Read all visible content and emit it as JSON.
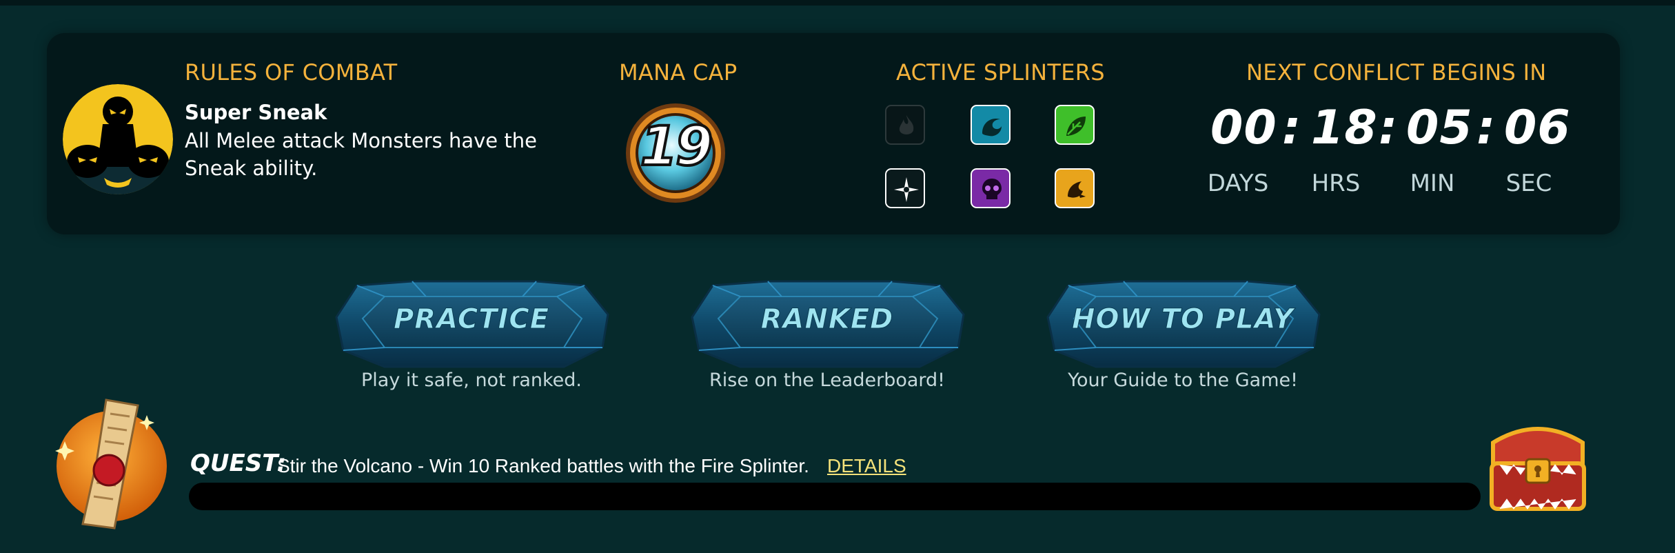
{
  "rules": {
    "header": "RULES OF COMBAT",
    "name": "Super Sneak",
    "description": "All Melee attack Monsters have the Sneak ability.",
    "icon": "super-sneak-icon"
  },
  "mana": {
    "header": "MANA CAP",
    "value": "19"
  },
  "splinters": {
    "header": "ACTIVE SPLINTERS",
    "items": [
      {
        "name": "fire",
        "active": false,
        "icon": "fire-splinter-icon",
        "color": "#3a3a3a"
      },
      {
        "name": "water",
        "active": true,
        "icon": "water-splinter-icon",
        "color": "#1fb6d8"
      },
      {
        "name": "earth",
        "active": true,
        "icon": "earth-splinter-icon",
        "color": "#2fb52f"
      },
      {
        "name": "life",
        "active": true,
        "icon": "life-splinter-icon",
        "color": "#f0f0f0"
      },
      {
        "name": "death",
        "active": true,
        "icon": "death-splinter-icon",
        "color": "#8a2fb0"
      },
      {
        "name": "dragon",
        "active": true,
        "icon": "dragon-splinter-icon",
        "color": "#f2b021"
      }
    ]
  },
  "timer": {
    "header": "NEXT CONFLICT BEGINS IN",
    "days": "00",
    "hrs": "18",
    "min": "05",
    "sec": "06",
    "sep": ":",
    "labels": {
      "days": "DAYS",
      "hrs": "HRS",
      "min": "MIN",
      "sec": "SEC"
    }
  },
  "modes": [
    {
      "label": "PRACTICE",
      "subtitle": "Play it safe, not ranked."
    },
    {
      "label": "RANKED",
      "subtitle": "Rise on the Leaderboard!"
    },
    {
      "label": "HOW TO PLAY",
      "subtitle": "Your Guide to the Game!"
    }
  ],
  "quest": {
    "title": "QUEST:",
    "text": "Stir the Volcano - Win 10 Ranked battles with the Fire Splinter.",
    "link": "DETAILS",
    "progress": 0,
    "icon": "quest-scroll-icon",
    "chest_icon": "treasure-chest-icon"
  },
  "colors": {
    "accent": "#f4b23c",
    "background": "#062a2c",
    "panel": "#03181a"
  }
}
